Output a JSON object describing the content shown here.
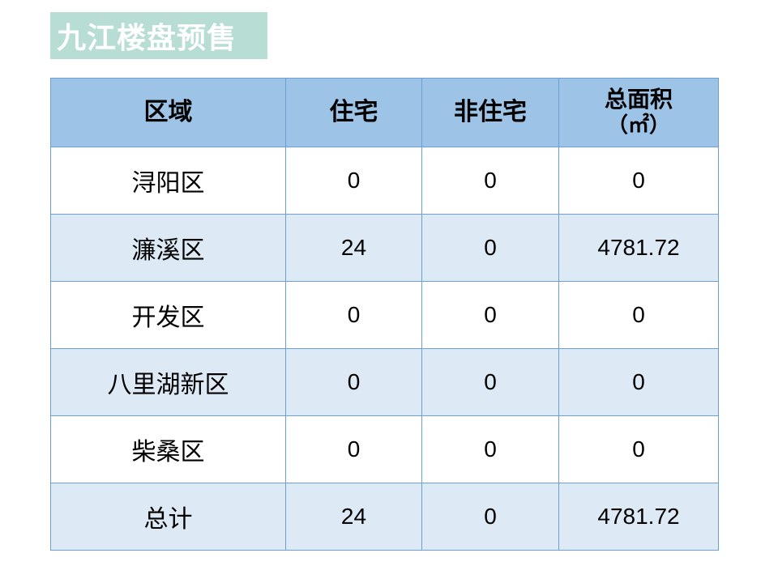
{
  "title": "九江楼盘预售",
  "table": {
    "headers": {
      "region": "区域",
      "residential": "住宅",
      "non_residential": "非住宅",
      "total_area": "总面积",
      "total_area_unit": "（㎡）"
    },
    "rows": [
      {
        "region": "浔阳区",
        "residential": "0",
        "non_residential": "0",
        "total_area": "0"
      },
      {
        "region": "濂溪区",
        "residential": "24",
        "non_residential": "0",
        "total_area": "4781.72"
      },
      {
        "region": "开发区",
        "residential": "0",
        "non_residential": "0",
        "total_area": "0"
      },
      {
        "region": "八里湖新区",
        "residential": "0",
        "non_residential": "0",
        "total_area": "0"
      },
      {
        "region": "柴桑区",
        "residential": "0",
        "non_residential": "0",
        "total_area": "0"
      },
      {
        "region": "总计",
        "residential": "24",
        "non_residential": "0",
        "total_area": "4781.72"
      }
    ]
  },
  "colors": {
    "title_bg": "#b7ddd5",
    "header_bg": "#9dc3e6",
    "stripe_bg": "#dde9f5",
    "border": "#6aa0d6"
  }
}
